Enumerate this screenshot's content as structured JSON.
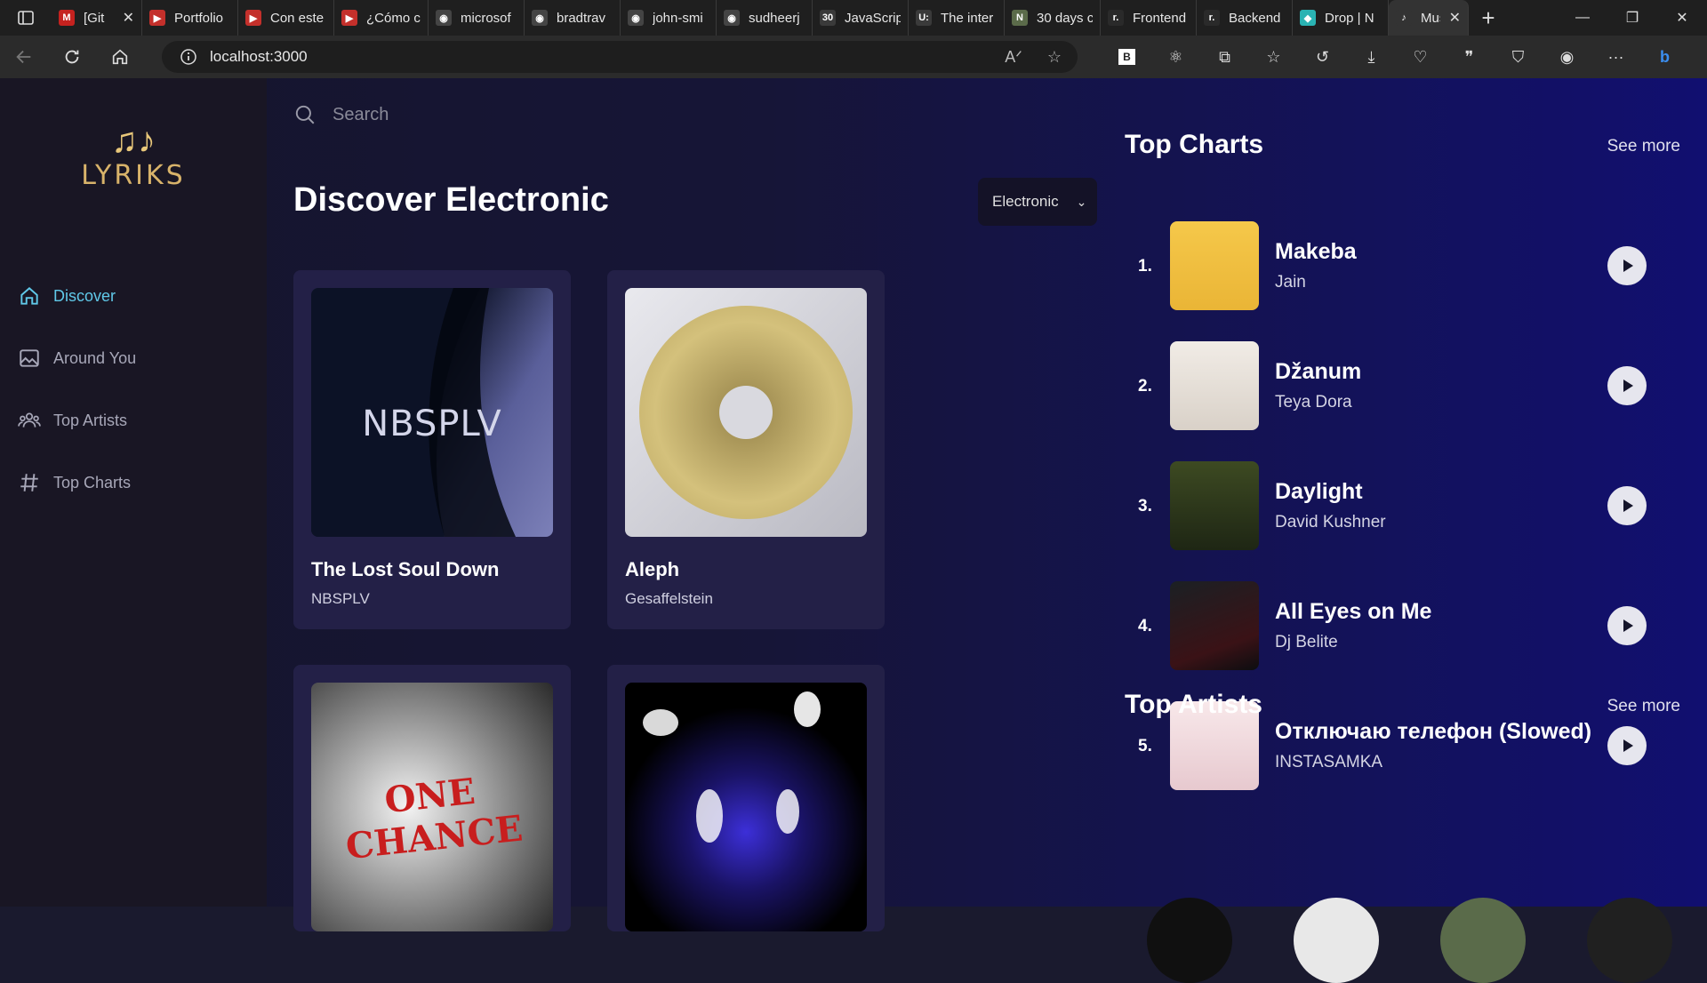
{
  "browser": {
    "tabs": [
      {
        "label": "[Git",
        "fav": "M",
        "color": "#c5221f"
      },
      {
        "label": "Portfolio",
        "fav": "▶",
        "color": "#c4302b"
      },
      {
        "label": "Con este",
        "fav": "▶",
        "color": "#c4302b"
      },
      {
        "label": "¿Cómo c",
        "fav": "▶",
        "color": "#c4302b"
      },
      {
        "label": "microsof",
        "fav": "◉",
        "color": "#444"
      },
      {
        "label": "bradtrav",
        "fav": "◉",
        "color": "#444"
      },
      {
        "label": "john-smi",
        "fav": "◉",
        "color": "#444"
      },
      {
        "label": "sudheerj",
        "fav": "◉",
        "color": "#444"
      },
      {
        "label": "JavaScrip",
        "fav": "30",
        "color": "#3a3a3a"
      },
      {
        "label": "The inter",
        "fav": "U:",
        "color": "#3a3a3a"
      },
      {
        "label": "30 days c",
        "fav": "N",
        "color": "#5b6b4a"
      },
      {
        "label": "Frontend",
        "fav": "r.",
        "color": "#2a2a2a"
      },
      {
        "label": "Backend",
        "fav": "r.",
        "color": "#2a2a2a"
      },
      {
        "label": "Drop | N",
        "fav": "◆",
        "color": "#2ab3b3"
      },
      {
        "label": "Mus",
        "fav": "♪",
        "color": "#333"
      }
    ],
    "url": "localhost:3000"
  },
  "app": {
    "brand": "LYRIKS",
    "search_placeholder": "Search",
    "page_title": "Discover Electronic",
    "genre_selected": "Electronic",
    "nav": [
      {
        "label": "Discover",
        "icon": "home-icon"
      },
      {
        "label": "Around You",
        "icon": "image-icon"
      },
      {
        "label": "Top Artists",
        "icon": "users-icon"
      },
      {
        "label": "Top Charts",
        "icon": "hashtag-icon"
      }
    ],
    "cards": [
      {
        "title": "The Lost Soul Down",
        "artist": "NBSPLV",
        "art_text": "NBSPLV"
      },
      {
        "title": "Aleph",
        "artist": "Gesaffelstein"
      },
      {
        "title": "",
        "artist": "",
        "art_text": "ONE CHANCE"
      },
      {
        "title": "",
        "artist": ""
      }
    ],
    "top_charts_title": "Top Charts",
    "top_artists_title": "Top Artists",
    "see_more": "See more",
    "charts": [
      {
        "rank": "1.",
        "song": "Makeba",
        "artist": "Jain"
      },
      {
        "rank": "2.",
        "song": "Džanum",
        "artist": "Teya Dora"
      },
      {
        "rank": "3.",
        "song": "Daylight",
        "artist": "David Kushner"
      },
      {
        "rank": "4.",
        "song": "All Eyes on Me",
        "artist": "Dj Belite"
      },
      {
        "rank": "5.",
        "song": "Отключаю телефон (Slowed)",
        "artist": "INSTASAMKA"
      }
    ],
    "colors": {
      "accent": "#60c8e8",
      "card": "#232047",
      "sidebar": "#191624"
    }
  }
}
